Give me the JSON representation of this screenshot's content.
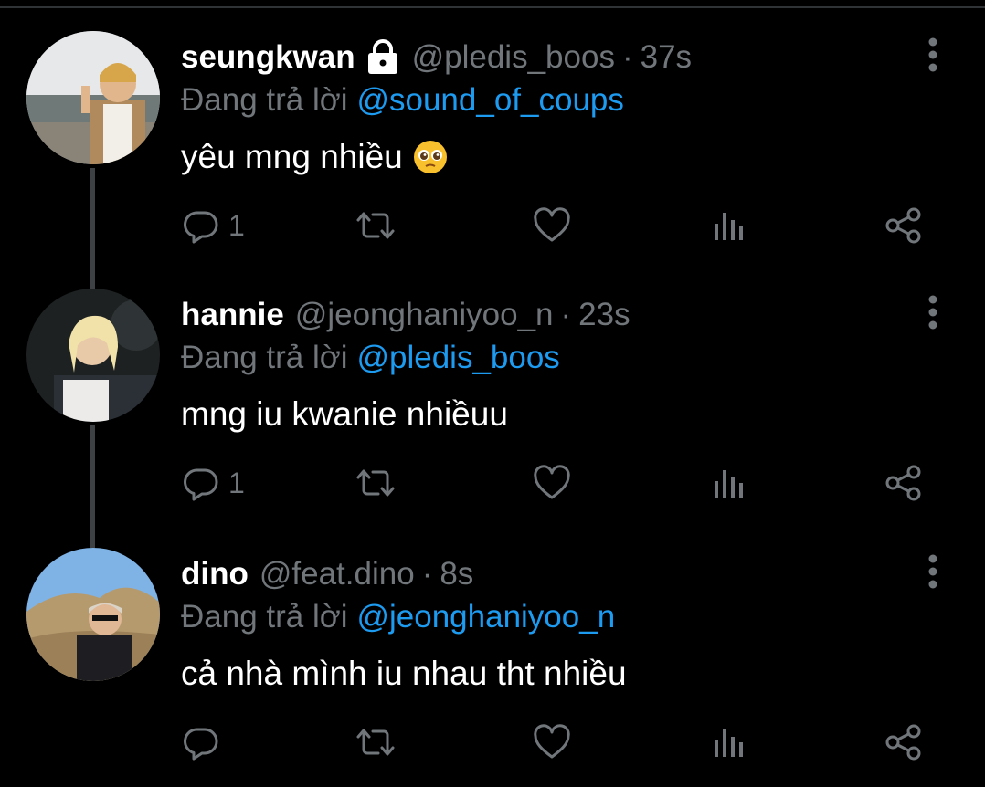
{
  "tweets": [
    {
      "display_name": "seungkwan",
      "protected": true,
      "handle": "@pledis_boos",
      "separator": "·",
      "time": "37s",
      "reply_prefix": "Đang trả lời",
      "reply_to": "@sound_of_coups",
      "text": "yêu mng nhiều",
      "emoji": "pleading-face",
      "reply_count": "1"
    },
    {
      "display_name": "hannie",
      "protected": false,
      "handle": "@jeonghaniyoo_n",
      "separator": "·",
      "time": "23s",
      "reply_prefix": "Đang trả lời",
      "reply_to": "@pledis_boos",
      "text": "mng iu kwanie nhiềuu",
      "reply_count": "1"
    },
    {
      "display_name": "dino",
      "protected": false,
      "handle": "@feat.dino",
      "separator": "·",
      "time": "8s",
      "reply_prefix": "Đang trả lời",
      "reply_to": "@jeonghaniyoo_n",
      "text": "cả nhà mình iu nhau tht nhiều",
      "reply_count": ""
    }
  ],
  "icons": {
    "reply": "reply-icon",
    "retweet": "retweet-icon",
    "like": "heart-icon",
    "views": "analytics-icon",
    "share": "share-icon",
    "more": "more-vertical-icon",
    "lock": "lock-icon"
  },
  "colors": {
    "background": "#000000",
    "text_primary": "#ffffff",
    "text_secondary": "#71767b",
    "link": "#1d9bf0",
    "thread_line": "#3e4144"
  }
}
